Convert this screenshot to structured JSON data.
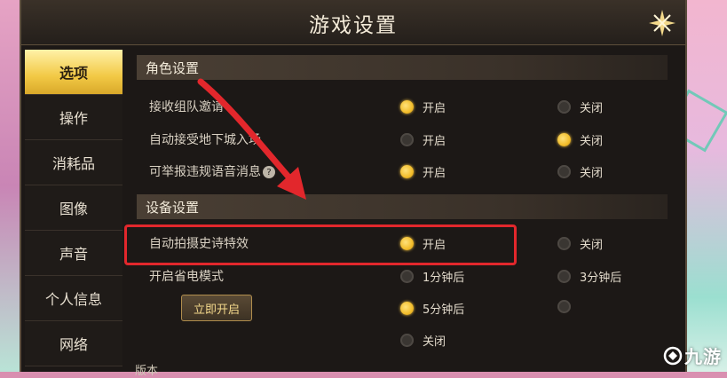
{
  "title": "游戏设置",
  "sidebar": {
    "items": [
      {
        "label": "选项",
        "active": true
      },
      {
        "label": "操作"
      },
      {
        "label": "消耗品"
      },
      {
        "label": "图像"
      },
      {
        "label": "声音"
      },
      {
        "label": "个人信息"
      },
      {
        "label": "网络"
      }
    ]
  },
  "sections": {
    "role": {
      "title": "角色设置",
      "rows": [
        {
          "label": "接收组队邀请",
          "on": "开启",
          "off": "关闭",
          "selected": "on"
        },
        {
          "label": "自动接受地下城入场",
          "on": "开启",
          "off": "关闭",
          "selected": "off"
        },
        {
          "label": "可举报违规语音消息",
          "on": "开启",
          "off": "关闭",
          "selected": "on"
        }
      ]
    },
    "device": {
      "title": "设备设置",
      "epic_row": {
        "label": "自动拍摄史诗特效",
        "on": "开启",
        "off": "关闭",
        "selected": "on"
      },
      "power_row": {
        "label": "开启省电模式",
        "options": [
          "1分钟后",
          "3分钟后",
          "5分钟后",
          "关闭"
        ],
        "selected": "5分钟后",
        "now_button": "立即开启"
      }
    }
  },
  "version_label": "版本",
  "watermark": "九游",
  "colors": {
    "accent_gold": "#f2bd2b",
    "highlight_red": "#e2272c",
    "panel_bg": "#1c1816"
  }
}
